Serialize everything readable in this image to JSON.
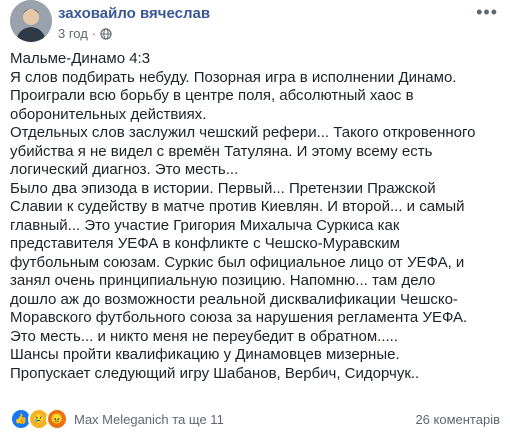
{
  "post": {
    "author": "заховайло вячеслав",
    "time": "3 год",
    "paragraphs": [
      "Мальме-Динамо 4:3",
      "Я слов подбирать небуду. Позорная игра в исполнении Динамо. Проиграли всю борьбу в центре поля, абсолютный хаос в оборонительных действиях.",
      "Отдельных слов заслужил чешский рефери... Такого откровенного убийства я не видел с времён Татуляна. И этому всему есть логический диагноз. Это месть...",
      "Было два эпизода в истории. Первый... Претензии Пражской Славии к судейству в матче против Киевлян. И второй... и самый главный... Это участие Григория Михалыча Суркиса как представителя УЕФА в конфликте с Чешско-Муравским футбольным союзам. Суркис был официальное лицо от УЕФА, и занял очень принципиальную позицию. Напомню... там дело дошло аж до возможности реальной дисквалификации Чешско-Моравского футбольного союза за нарушения регламента УЕФА.",
      "Это месть... и никто меня не переубедит в обратном.....",
      "Шансы пройти квалификацию у Динамовцев мизерные. Пропускает следующий игру Шабанов, Вербич, Сидорчук.."
    ]
  },
  "footer": {
    "reactions": [
      "like-icon",
      "sad-icon",
      "angry-icon"
    ],
    "reactors_text": "Max Meleganich та ще 11",
    "comments": "26 коментарів"
  },
  "colors": {
    "author": "#385898",
    "text": "#1d2129",
    "meta": "#606770"
  }
}
